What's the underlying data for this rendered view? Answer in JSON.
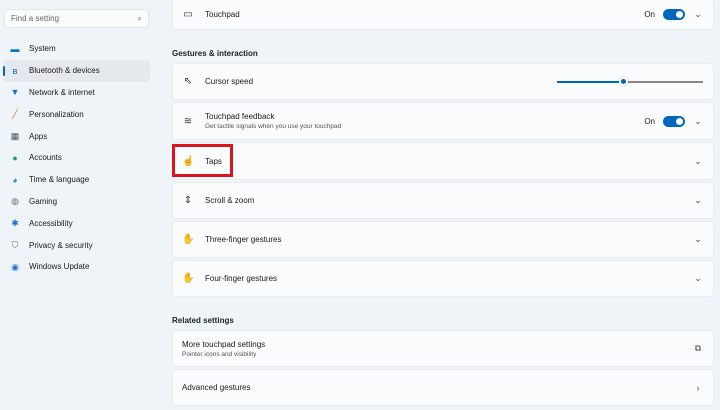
{
  "search": {
    "placeholder": "Find a setting",
    "icon": "search-icon"
  },
  "sidebar": {
    "items": [
      {
        "label": "System",
        "icon": "monitor-icon",
        "color": "#0e75c4",
        "active": false
      },
      {
        "label": "Bluetooth & devices",
        "icon": "bluetooth-icon",
        "color": "#0067c0",
        "active": true
      },
      {
        "label": "Network & internet",
        "icon": "wifi-icon",
        "color": "#0e75c4",
        "active": false
      },
      {
        "label": "Personalization",
        "icon": "brush-icon",
        "color": "#e07a2b",
        "active": false
      },
      {
        "label": "Apps",
        "icon": "apps-icon",
        "color": "#44546a",
        "active": false
      },
      {
        "label": "Accounts",
        "icon": "person-icon",
        "color": "#1aa37a",
        "active": false
      },
      {
        "label": "Time & language",
        "icon": "globe-clock-icon",
        "color": "#1e88c8",
        "active": false
      },
      {
        "label": "Gaming",
        "icon": "gamepad-icon",
        "color": "#707070",
        "active": false
      },
      {
        "label": "Accessibility",
        "icon": "accessibility-icon",
        "color": "#1a73d0",
        "active": false
      },
      {
        "label": "Privacy & security",
        "icon": "shield-icon",
        "color": "#707070",
        "active": false
      },
      {
        "label": "Windows Update",
        "icon": "update-icon",
        "color": "#1a73d0",
        "active": false
      }
    ]
  },
  "touchpad": {
    "label": "Touchpad",
    "state": "On"
  },
  "gestures": {
    "header": "Gestures & interaction",
    "cursor_speed": {
      "label": "Cursor speed",
      "value_percent": 45
    },
    "feedback": {
      "label": "Touchpad feedback",
      "sub": "Get tactile signals when you use your touchpad",
      "state": "On"
    },
    "taps": {
      "label": "Taps"
    },
    "scroll": {
      "label": "Scroll & zoom"
    },
    "three": {
      "label": "Three-finger gestures"
    },
    "four": {
      "label": "Four-finger gestures"
    }
  },
  "related": {
    "header": "Related settings",
    "more": {
      "label": "More touchpad settings",
      "sub": "Pointer icons and visibility"
    },
    "advanced": {
      "label": "Advanced gestures"
    }
  },
  "colors": {
    "accent": "#0067c0",
    "highlight": "#e0131b"
  }
}
